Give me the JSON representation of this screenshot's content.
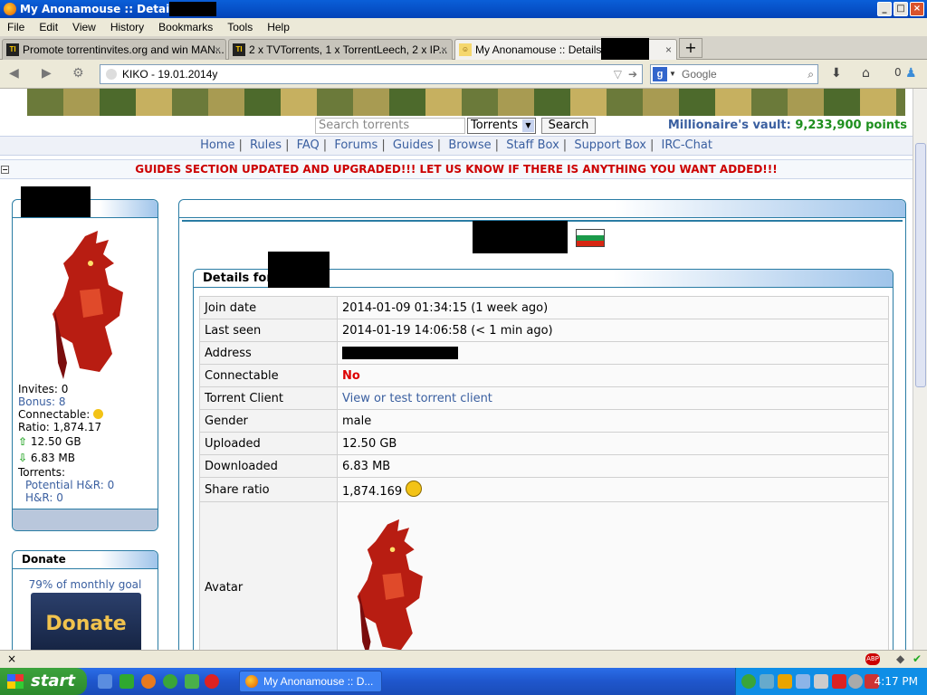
{
  "window": {
    "title": "My Anonamouse :: Details for",
    "controls": [
      "_",
      "□",
      "×"
    ]
  },
  "menu": [
    "File",
    "Edit",
    "View",
    "History",
    "Bookmarks",
    "Tools",
    "Help"
  ],
  "tabs": [
    {
      "label": "Promote torrentinvites.org and win MAN...",
      "icon": "TI"
    },
    {
      "label": "2 x TVTorrents, 1 x TorrentLeech, 2 x IP...",
      "icon": "TI"
    },
    {
      "label": "My Anonamouse :: Details for",
      "icon": "mam"
    }
  ],
  "nav": {
    "url": "KIKO - 19.01.2014y",
    "search_placeholder": "Google",
    "download_count": "0"
  },
  "site": {
    "search_placeholder": "Search torrents",
    "search_scope": "Torrents",
    "search_button": "Search",
    "vault_label": "Millionaire's vault:",
    "vault_value": "9,233,900 points",
    "links": [
      "Home",
      "Rules",
      "FAQ",
      "Forums",
      "Guides",
      "Browse",
      "Staff Box",
      "Support Box",
      "IRC-Chat"
    ],
    "announcement": "GUIDES SECTION UPDATED AND UPGRADED!!! LET US KNOW IF THERE IS ANYTHING YOU WANT ADDED!!!"
  },
  "sidebar": {
    "invites": "Invites: 0",
    "bonus": "Bonus: 8",
    "connectable": "Connectable:",
    "ratio": "Ratio: 1,874.17",
    "uploaded": "12.50 GB",
    "downloaded": "6.83 MB",
    "torrents": "Torrents:",
    "potential_hnr": "Potential H&R: 0",
    "hnr": "H&R:  0",
    "donate_title": "Donate",
    "donate_goal": "79% of monthly goal",
    "donate_button": "Donate"
  },
  "details": {
    "title": "Details for",
    "rows": [
      {
        "key": "Join date",
        "value": "2014-01-09 01:34:15 (1 week ago)"
      },
      {
        "key": "Last seen",
        "value": "2014-01-19 14:06:58 (< 1 min ago)"
      },
      {
        "key": "Address",
        "value": ""
      },
      {
        "key": "Connectable",
        "value": "No"
      },
      {
        "key": "Torrent Client",
        "value": "View or test torrent client"
      },
      {
        "key": "Gender",
        "value": "male"
      },
      {
        "key": "Uploaded",
        "value": "12.50 GB"
      },
      {
        "key": "Downloaded",
        "value": "6.83 MB"
      },
      {
        "key": "Share ratio",
        "value": "1,874.169"
      },
      {
        "key": "Avatar",
        "value": ""
      }
    ]
  },
  "taskbar": {
    "start": "start",
    "window_button": "My Anonamouse :: D...",
    "clock": "4:17 PM"
  }
}
